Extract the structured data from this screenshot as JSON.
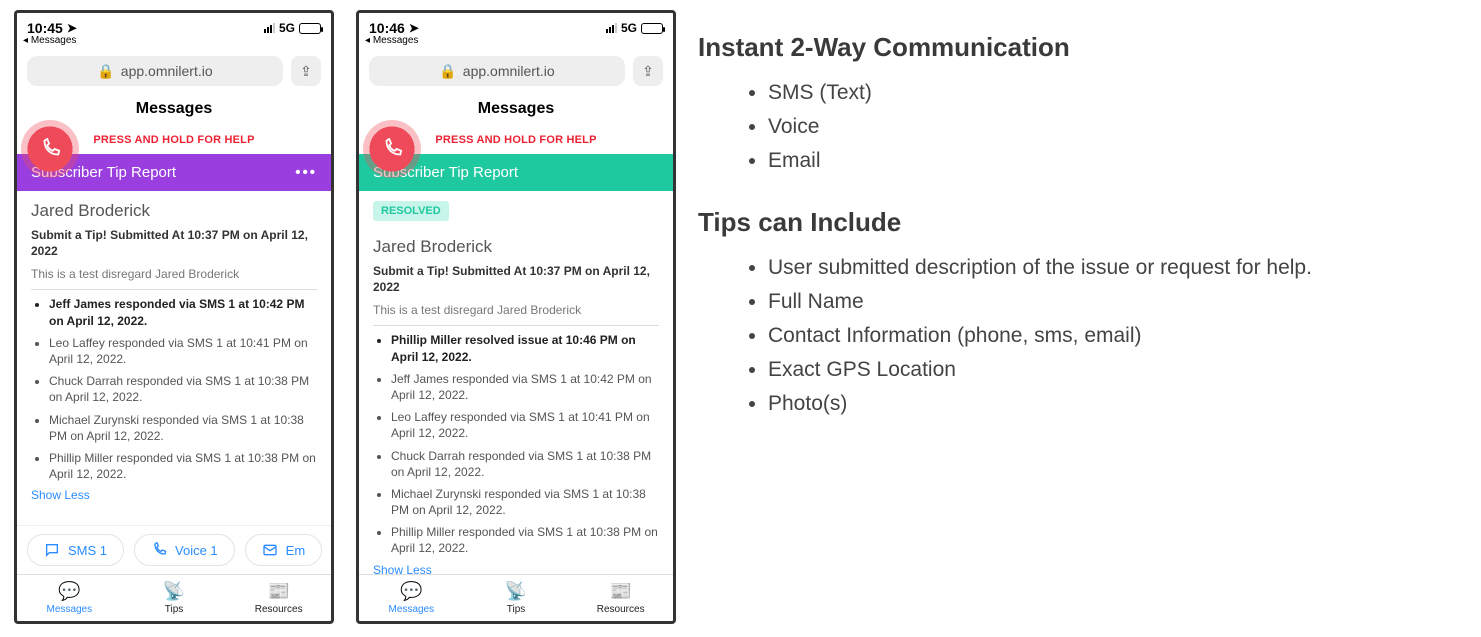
{
  "phone1": {
    "time": "10:45",
    "back": "Messages",
    "network": "5G",
    "url": "app.omnilert.io",
    "headerTitle": "Messages",
    "helpText": "PRESS AND HOLD FOR HELP",
    "bannerTitle": "Subscriber Tip Report",
    "bannerDots": "•••",
    "person": "Jared Broderick",
    "subline": "Submit a Tip! Submitted At 10:37 PM on April 12, 2022",
    "desc": "This is a test disregard Jared Broderick",
    "responses": [
      {
        "text": "Jeff James responded via SMS 1 at 10:42 PM on April 12, 2022.",
        "bold": true
      },
      {
        "text": "Leo Laffey responded via SMS 1 at 10:41 PM on April 12, 2022.",
        "bold": false
      },
      {
        "text": "Chuck Darrah responded via SMS 1 at 10:38 PM on April 12, 2022.",
        "bold": false
      },
      {
        "text": "Michael Zurynski responded via SMS 1 at 10:38 PM on April 12, 2022.",
        "bold": false
      },
      {
        "text": "Phillip Miller responded via SMS 1 at 10:38 PM on April 12, 2022.",
        "bold": false
      }
    ],
    "showLess": "Show Less",
    "actions": {
      "sms": "SMS 1",
      "voice": "Voice 1",
      "email": "Em"
    },
    "tabs": {
      "messages": "Messages",
      "tips": "Tips",
      "resources": "Resources"
    }
  },
  "phone2": {
    "time": "10:46",
    "back": "Messages",
    "network": "5G",
    "url": "app.omnilert.io",
    "headerTitle": "Messages",
    "helpText": "PRESS AND HOLD FOR HELP",
    "bannerTitle": "Subscriber Tip Report",
    "resolved": "RESOLVED",
    "person": "Jared Broderick",
    "subline": "Submit a Tip! Submitted At 10:37 PM on April 12, 2022",
    "desc": "This is a test disregard Jared Broderick",
    "responses": [
      {
        "text": "Phillip Miller resolved issue at 10:46 PM on April 12, 2022.",
        "bold": true
      },
      {
        "text": "Jeff James responded via SMS 1 at 10:42 PM on April 12, 2022.",
        "bold": false
      },
      {
        "text": "Leo Laffey responded via SMS 1 at 10:41 PM on April 12, 2022.",
        "bold": false
      },
      {
        "text": "Chuck Darrah responded via SMS 1 at 10:38 PM on April 12, 2022.",
        "bold": false
      },
      {
        "text": "Michael Zurynski responded via SMS 1 at 10:38 PM on April 12, 2022.",
        "bold": false
      },
      {
        "text": "Phillip Miller responded via SMS 1 at 10:38 PM on April 12, 2022.",
        "bold": false
      }
    ],
    "showLess": "Show Less",
    "tabs": {
      "messages": "Messages",
      "tips": "Tips",
      "resources": "Resources"
    }
  },
  "right": {
    "h1": "Instant 2-Way Communication",
    "list1": [
      "SMS (Text)",
      "Voice",
      "Email"
    ],
    "h2": "Tips can Include",
    "list2": [
      "User submitted description of the issue or request for help.",
      "Full Name",
      "Contact Information (phone, sms, email)",
      "Exact GPS Location",
      "Photo(s)"
    ]
  }
}
